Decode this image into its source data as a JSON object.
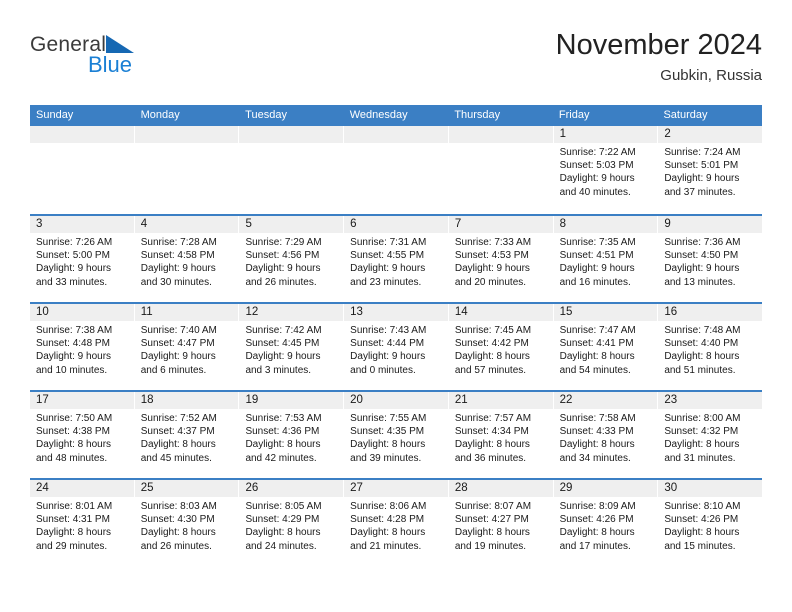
{
  "brand": {
    "name_part1": "General",
    "name_part2": "Blue",
    "triangle_icon": "blue-triangle-icon",
    "accent_color": "#1a7fd4"
  },
  "header": {
    "title": "November 2024",
    "subtitle": "Gubkin, Russia"
  },
  "calendar": {
    "header_bg": "#3b7fc4",
    "daynum_bg": "#efefef",
    "weekdays": [
      "Sunday",
      "Monday",
      "Tuesday",
      "Wednesday",
      "Thursday",
      "Friday",
      "Saturday"
    ],
    "weeks": [
      [
        {
          "day": "",
          "empty": true
        },
        {
          "day": "",
          "empty": true
        },
        {
          "day": "",
          "empty": true
        },
        {
          "day": "",
          "empty": true
        },
        {
          "day": "",
          "empty": true
        },
        {
          "day": "1",
          "sunrise": "Sunrise: 7:22 AM",
          "sunset": "Sunset: 5:03 PM",
          "daylight_line1": "Daylight: 9 hours",
          "daylight_line2": "and 40 minutes."
        },
        {
          "day": "2",
          "sunrise": "Sunrise: 7:24 AM",
          "sunset": "Sunset: 5:01 PM",
          "daylight_line1": "Daylight: 9 hours",
          "daylight_line2": "and 37 minutes."
        }
      ],
      [
        {
          "day": "3",
          "sunrise": "Sunrise: 7:26 AM",
          "sunset": "Sunset: 5:00 PM",
          "daylight_line1": "Daylight: 9 hours",
          "daylight_line2": "and 33 minutes."
        },
        {
          "day": "4",
          "sunrise": "Sunrise: 7:28 AM",
          "sunset": "Sunset: 4:58 PM",
          "daylight_line1": "Daylight: 9 hours",
          "daylight_line2": "and 30 minutes."
        },
        {
          "day": "5",
          "sunrise": "Sunrise: 7:29 AM",
          "sunset": "Sunset: 4:56 PM",
          "daylight_line1": "Daylight: 9 hours",
          "daylight_line2": "and 26 minutes."
        },
        {
          "day": "6",
          "sunrise": "Sunrise: 7:31 AM",
          "sunset": "Sunset: 4:55 PM",
          "daylight_line1": "Daylight: 9 hours",
          "daylight_line2": "and 23 minutes."
        },
        {
          "day": "7",
          "sunrise": "Sunrise: 7:33 AM",
          "sunset": "Sunset: 4:53 PM",
          "daylight_line1": "Daylight: 9 hours",
          "daylight_line2": "and 20 minutes."
        },
        {
          "day": "8",
          "sunrise": "Sunrise: 7:35 AM",
          "sunset": "Sunset: 4:51 PM",
          "daylight_line1": "Daylight: 9 hours",
          "daylight_line2": "and 16 minutes."
        },
        {
          "day": "9",
          "sunrise": "Sunrise: 7:36 AM",
          "sunset": "Sunset: 4:50 PM",
          "daylight_line1": "Daylight: 9 hours",
          "daylight_line2": "and 13 minutes."
        }
      ],
      [
        {
          "day": "10",
          "sunrise": "Sunrise: 7:38 AM",
          "sunset": "Sunset: 4:48 PM",
          "daylight_line1": "Daylight: 9 hours",
          "daylight_line2": "and 10 minutes."
        },
        {
          "day": "11",
          "sunrise": "Sunrise: 7:40 AM",
          "sunset": "Sunset: 4:47 PM",
          "daylight_line1": "Daylight: 9 hours",
          "daylight_line2": "and 6 minutes."
        },
        {
          "day": "12",
          "sunrise": "Sunrise: 7:42 AM",
          "sunset": "Sunset: 4:45 PM",
          "daylight_line1": "Daylight: 9 hours",
          "daylight_line2": "and 3 minutes."
        },
        {
          "day": "13",
          "sunrise": "Sunrise: 7:43 AM",
          "sunset": "Sunset: 4:44 PM",
          "daylight_line1": "Daylight: 9 hours",
          "daylight_line2": "and 0 minutes."
        },
        {
          "day": "14",
          "sunrise": "Sunrise: 7:45 AM",
          "sunset": "Sunset: 4:42 PM",
          "daylight_line1": "Daylight: 8 hours",
          "daylight_line2": "and 57 minutes."
        },
        {
          "day": "15",
          "sunrise": "Sunrise: 7:47 AM",
          "sunset": "Sunset: 4:41 PM",
          "daylight_line1": "Daylight: 8 hours",
          "daylight_line2": "and 54 minutes."
        },
        {
          "day": "16",
          "sunrise": "Sunrise: 7:48 AM",
          "sunset": "Sunset: 4:40 PM",
          "daylight_line1": "Daylight: 8 hours",
          "daylight_line2": "and 51 minutes."
        }
      ],
      [
        {
          "day": "17",
          "sunrise": "Sunrise: 7:50 AM",
          "sunset": "Sunset: 4:38 PM",
          "daylight_line1": "Daylight: 8 hours",
          "daylight_line2": "and 48 minutes."
        },
        {
          "day": "18",
          "sunrise": "Sunrise: 7:52 AM",
          "sunset": "Sunset: 4:37 PM",
          "daylight_line1": "Daylight: 8 hours",
          "daylight_line2": "and 45 minutes."
        },
        {
          "day": "19",
          "sunrise": "Sunrise: 7:53 AM",
          "sunset": "Sunset: 4:36 PM",
          "daylight_line1": "Daylight: 8 hours",
          "daylight_line2": "and 42 minutes."
        },
        {
          "day": "20",
          "sunrise": "Sunrise: 7:55 AM",
          "sunset": "Sunset: 4:35 PM",
          "daylight_line1": "Daylight: 8 hours",
          "daylight_line2": "and 39 minutes."
        },
        {
          "day": "21",
          "sunrise": "Sunrise: 7:57 AM",
          "sunset": "Sunset: 4:34 PM",
          "daylight_line1": "Daylight: 8 hours",
          "daylight_line2": "and 36 minutes."
        },
        {
          "day": "22",
          "sunrise": "Sunrise: 7:58 AM",
          "sunset": "Sunset: 4:33 PM",
          "daylight_line1": "Daylight: 8 hours",
          "daylight_line2": "and 34 minutes."
        },
        {
          "day": "23",
          "sunrise": "Sunrise: 8:00 AM",
          "sunset": "Sunset: 4:32 PM",
          "daylight_line1": "Daylight: 8 hours",
          "daylight_line2": "and 31 minutes."
        }
      ],
      [
        {
          "day": "24",
          "sunrise": "Sunrise: 8:01 AM",
          "sunset": "Sunset: 4:31 PM",
          "daylight_line1": "Daylight: 8 hours",
          "daylight_line2": "and 29 minutes."
        },
        {
          "day": "25",
          "sunrise": "Sunrise: 8:03 AM",
          "sunset": "Sunset: 4:30 PM",
          "daylight_line1": "Daylight: 8 hours",
          "daylight_line2": "and 26 minutes."
        },
        {
          "day": "26",
          "sunrise": "Sunrise: 8:05 AM",
          "sunset": "Sunset: 4:29 PM",
          "daylight_line1": "Daylight: 8 hours",
          "daylight_line2": "and 24 minutes."
        },
        {
          "day": "27",
          "sunrise": "Sunrise: 8:06 AM",
          "sunset": "Sunset: 4:28 PM",
          "daylight_line1": "Daylight: 8 hours",
          "daylight_line2": "and 21 minutes."
        },
        {
          "day": "28",
          "sunrise": "Sunrise: 8:07 AM",
          "sunset": "Sunset: 4:27 PM",
          "daylight_line1": "Daylight: 8 hours",
          "daylight_line2": "and 19 minutes."
        },
        {
          "day": "29",
          "sunrise": "Sunrise: 8:09 AM",
          "sunset": "Sunset: 4:26 PM",
          "daylight_line1": "Daylight: 8 hours",
          "daylight_line2": "and 17 minutes."
        },
        {
          "day": "30",
          "sunrise": "Sunrise: 8:10 AM",
          "sunset": "Sunset: 4:26 PM",
          "daylight_line1": "Daylight: 8 hours",
          "daylight_line2": "and 15 minutes."
        }
      ]
    ]
  }
}
